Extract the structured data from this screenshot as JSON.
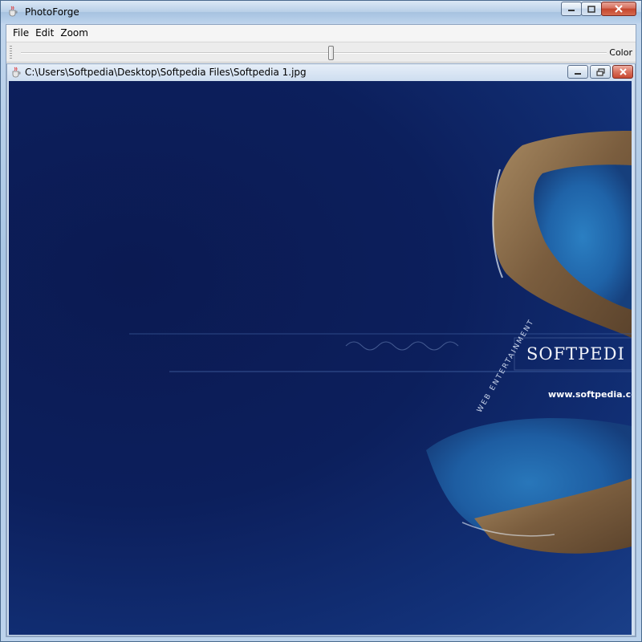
{
  "window": {
    "title": "PhotoForge",
    "icons": {
      "app": "java-cup-icon",
      "minimize": "minimize-icon",
      "maximize": "maximize-icon",
      "close": "close-icon"
    }
  },
  "menubar": {
    "items": [
      {
        "label": "File"
      },
      {
        "label": "Edit"
      },
      {
        "label": "Zoom"
      }
    ]
  },
  "toolbar": {
    "slider_label": "Color",
    "slider_value": 0.53
  },
  "document": {
    "title": "C:\\Users\\Softpedia\\Desktop\\Softpedia Files\\Softpedia 1.jpg",
    "icons": {
      "doc": "java-cup-icon",
      "minimize": "minimize-icon",
      "restore": "restore-icon",
      "close": "close-icon"
    }
  },
  "image": {
    "brand": "SOFTPEDI",
    "url": "www.softpedia.com",
    "tagline": "WEB ENTERTAINMENT"
  },
  "colors": {
    "canvas_bg": "#0c1f5c",
    "close_red": "#c84a32",
    "chrome_blue": "#b9d1ea"
  }
}
